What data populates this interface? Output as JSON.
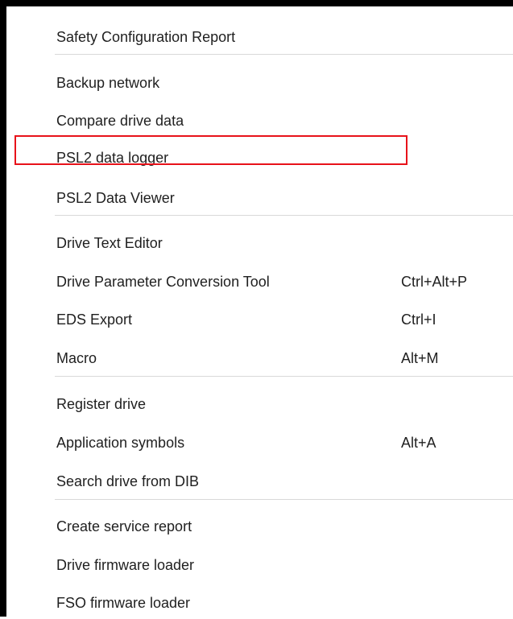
{
  "menu": {
    "items": [
      {
        "label": "Safety Configuration Report",
        "shortcut": ""
      },
      {
        "label": "Backup network",
        "shortcut": ""
      },
      {
        "label": "Compare drive data",
        "shortcut": ""
      },
      {
        "label": "PSL2 data logger",
        "shortcut": ""
      },
      {
        "label": "PSL2 Data Viewer",
        "shortcut": ""
      },
      {
        "label": "Drive Text Editor",
        "shortcut": ""
      },
      {
        "label": "Drive Parameter Conversion Tool",
        "shortcut": "Ctrl+Alt+P"
      },
      {
        "label": "EDS Export",
        "shortcut": "Ctrl+I"
      },
      {
        "label": "Macro",
        "shortcut": "Alt+M"
      },
      {
        "label": "Register drive",
        "shortcut": ""
      },
      {
        "label": "Application symbols",
        "shortcut": "Alt+A"
      },
      {
        "label": "Search drive from DIB",
        "shortcut": ""
      },
      {
        "label": "Create service report",
        "shortcut": ""
      },
      {
        "label": "Drive firmware loader",
        "shortcut": ""
      },
      {
        "label": "FSO firmware loader",
        "shortcut": ""
      }
    ]
  },
  "colors": {
    "highlight_border": "#e8121a",
    "separator": "#d9d9d9",
    "frame": "#000000"
  }
}
